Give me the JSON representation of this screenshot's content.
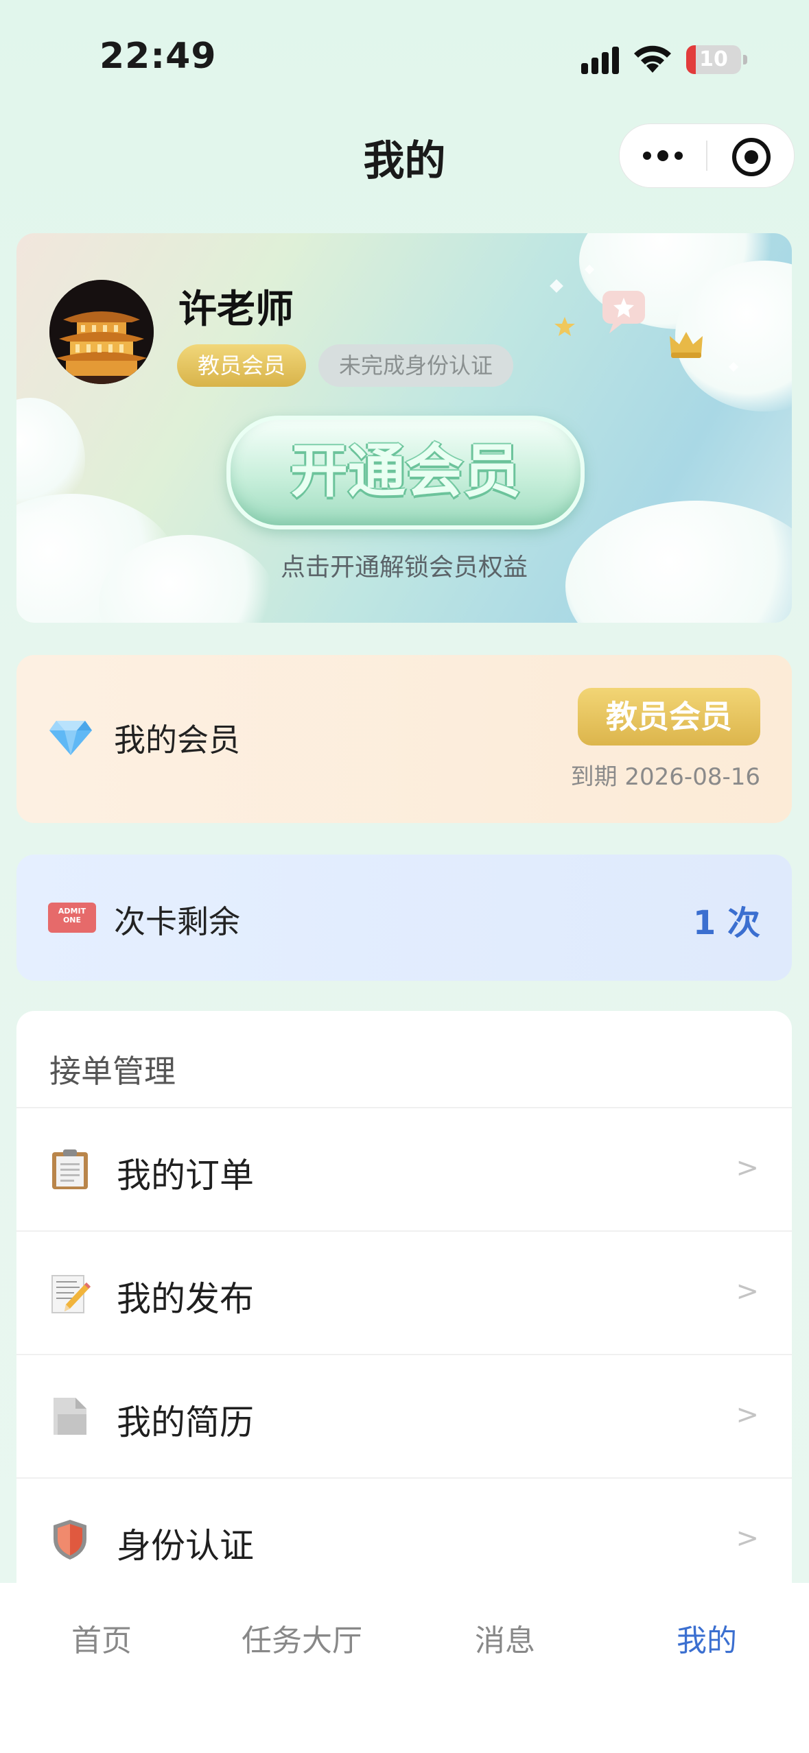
{
  "status_bar": {
    "time": "22:49",
    "battery": "10"
  },
  "nav": {
    "title": "我的"
  },
  "profile": {
    "name": "许老师",
    "badge_member": "教员会员",
    "badge_verify": "未完成身份认证",
    "open_button": "开通会员",
    "unlock_hint": "点击开通解锁会员权益"
  },
  "member": {
    "label": "我的会员",
    "badge": "教员会员",
    "expiry": "到期 2026-08-16",
    "icon": "diamond-icon"
  },
  "card_count": {
    "label": "次卡剩余",
    "value": "1 次",
    "icon": "ticket-icon",
    "ticket_text": "ADMIT ONE"
  },
  "manage": {
    "title": "接单管理",
    "items": [
      {
        "label": "我的订单",
        "icon": "clipboard-icon",
        "arrow": ">"
      },
      {
        "label": "我的发布",
        "icon": "memo-icon",
        "arrow": ">"
      },
      {
        "label": "我的简历",
        "icon": "document-icon",
        "arrow": ">"
      },
      {
        "label": "身份认证",
        "icon": "shield-icon",
        "arrow": ">"
      }
    ]
  },
  "tabbar": {
    "items": [
      {
        "label": "首页"
      },
      {
        "label": "任务大厅"
      },
      {
        "label": "消息"
      },
      {
        "label": "我的"
      }
    ],
    "active": "我的"
  },
  "colors": {
    "accent": "#3b6fd0",
    "gold": "#dcb54c",
    "mint": "#9fdcc0"
  }
}
